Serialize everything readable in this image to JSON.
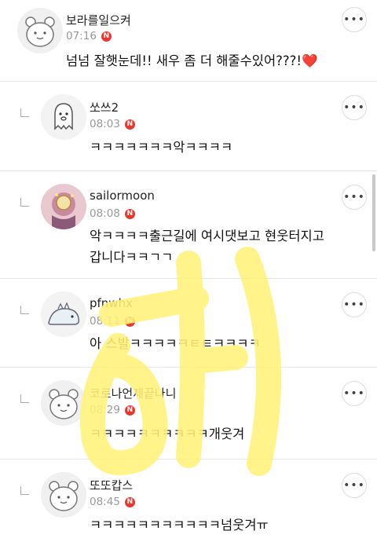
{
  "comments": [
    {
      "nick": "보라를일으켜",
      "time": "07:16",
      "badge": "N",
      "lines": [
        "넘넘 잘햇눈데!! 새우 좀 더 해줄수있어???!"
      ],
      "emoji": "❤️",
      "avatar": "hamster-avatar-icon",
      "reply": false
    },
    {
      "nick": "쏘쓰2",
      "time": "08:03",
      "badge": "N",
      "lines": [
        "ㅋㅋㅋㅋㅋㅋㅋ악ㅋㅋㅋㅋ"
      ],
      "avatar": "ghost-avatar-icon",
      "reply": true
    },
    {
      "nick": "sailormoon",
      "time": "08:08",
      "badge": "N",
      "lines": [
        "악ㅋㅋㅋㅋ출근길에 여시댓보고 현웃터지고",
        "갑니다ㅋㅋㄱㄱ"
      ],
      "avatar": "sailormoon-avatar-icon",
      "reply": true
    },
    {
      "nick": "pfnwhx",
      "time": "08:11",
      "badge": "N",
      "lines": [
        "아 스발ㅋㅋㅋㅋㅋㅌㅌㅋㅋㅋㅋ"
      ],
      "avatar": "dinosaur-avatar-icon",
      "reply": true
    },
    {
      "nick": "코로나언제끝나니",
      "time": "08:29",
      "badge": "N",
      "lines": [
        "ㅋㅋㅋㅋㅋㅋㅋㅋㅋㅋ개웃겨"
      ],
      "avatar": "hamster-avatar-icon",
      "reply": true
    },
    {
      "nick": "또또캅스",
      "time": "08:45",
      "badge": "N",
      "lines": [
        "ㅋㅋㅋㅋㅋㅋㅋㅋㅋㅋㅋ넘웃겨ㅠ"
      ],
      "avatar": "hamster-avatar-icon",
      "reply": true
    }
  ],
  "more_label": "•••",
  "watermark_text": "허니",
  "colors": {
    "badge": "#e8372f",
    "watermark": "#fff27a",
    "divider": "#e6e6e6"
  }
}
